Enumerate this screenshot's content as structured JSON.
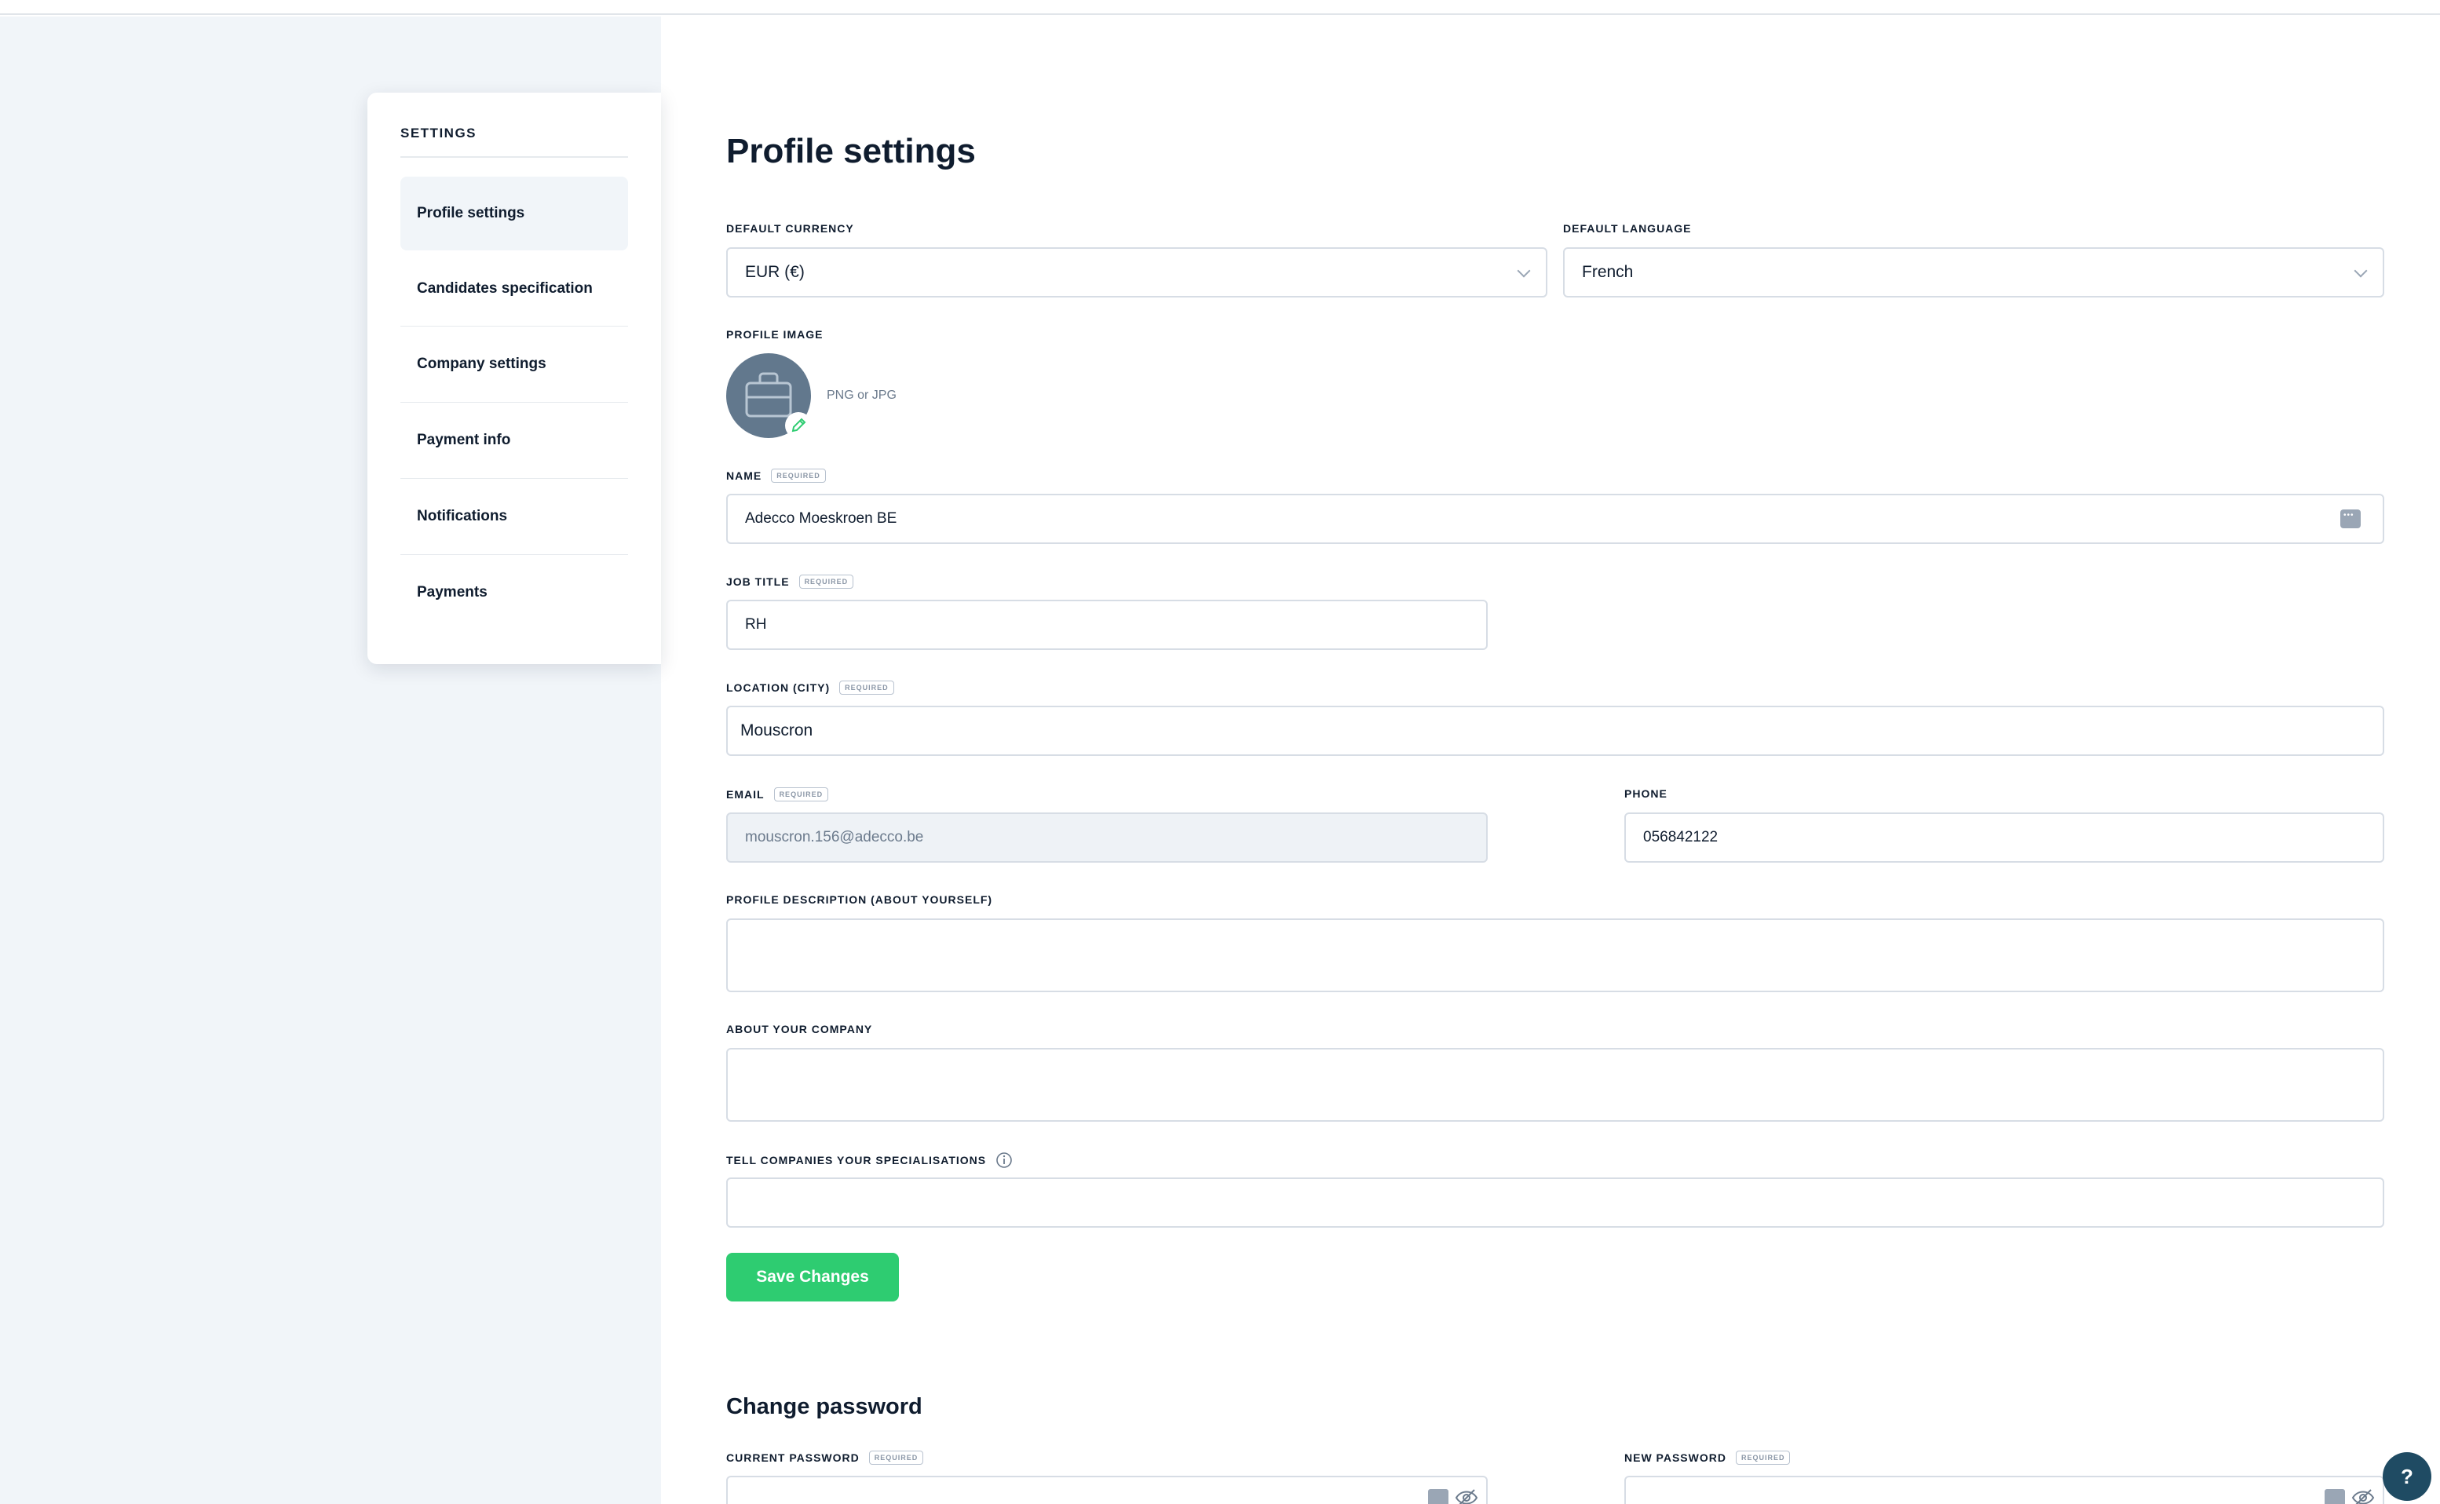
{
  "sidebar": {
    "title": "SETTINGS",
    "items": [
      {
        "label": "Profile settings",
        "active": true
      },
      {
        "label": "Candidates specification"
      },
      {
        "label": "Company settings"
      },
      {
        "label": "Payment info"
      },
      {
        "label": "Notifications"
      },
      {
        "label": "Payments"
      }
    ]
  },
  "main": {
    "title": "Profile settings",
    "required_badge": "REQUIRED",
    "default_currency": {
      "label": "DEFAULT CURRENCY",
      "value": "EUR (€)"
    },
    "default_language": {
      "label": "DEFAULT LANGUAGE",
      "value": "French"
    },
    "profile_image": {
      "label": "PROFILE IMAGE",
      "hint": "PNG or JPG"
    },
    "name": {
      "label": "NAME",
      "value": "Adecco Moeskroen BE"
    },
    "job_title": {
      "label": "JOB TITLE",
      "value": "RH"
    },
    "location": {
      "label": "LOCATION (CITY)",
      "value": "Mouscron"
    },
    "email": {
      "label": "EMAIL",
      "value": "mouscron.156@adecco.be"
    },
    "phone": {
      "label": "PHONE",
      "value": "056842122"
    },
    "profile_description": {
      "label": "PROFILE DESCRIPTION (ABOUT YOURSELF)",
      "value": ""
    },
    "about_company": {
      "label": "ABOUT YOUR COMPANY",
      "value": ""
    },
    "specialisations": {
      "label": "TELL COMPANIES YOUR SPECIALISATIONS",
      "value": ""
    },
    "save_label": "Save Changes"
  },
  "password": {
    "title": "Change password",
    "current": {
      "label": "CURRENT PASSWORD"
    },
    "new": {
      "label": "NEW PASSWORD"
    }
  },
  "help_label": "?",
  "colors": {
    "accent": "#2ecc71",
    "avatar": "#62788d",
    "help": "#1f4b63",
    "sidebar_bg": "#f1f5f9"
  }
}
